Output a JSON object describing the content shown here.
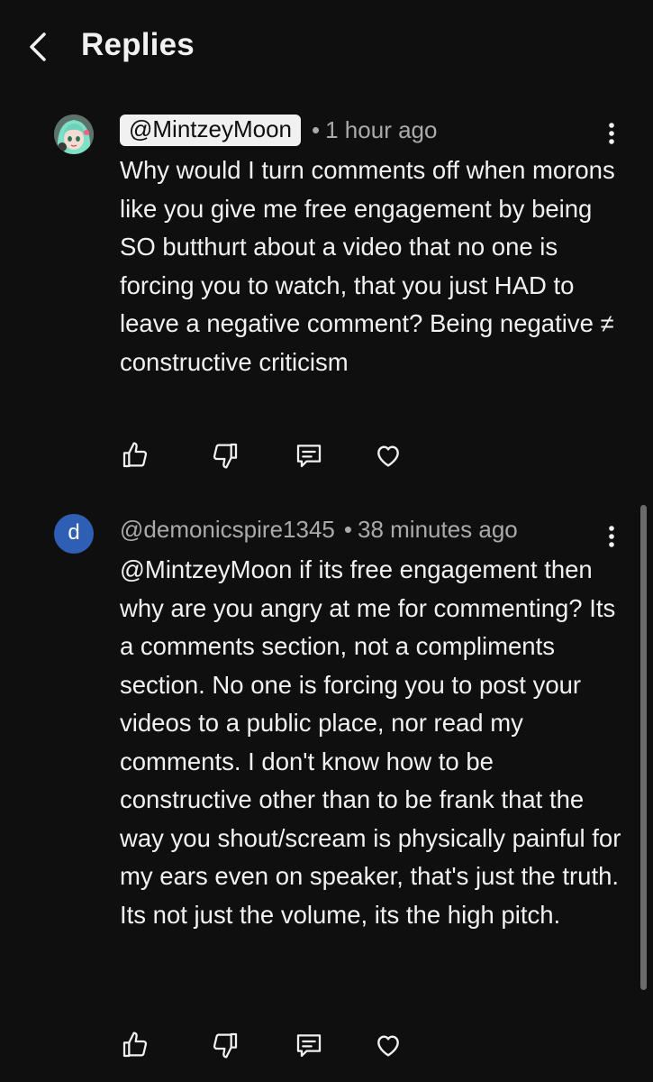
{
  "header": {
    "title": "Replies",
    "back_icon": "chevron-left-icon"
  },
  "comments": [
    {
      "author": "@MintzeyMoon",
      "author_highlight": true,
      "separator": "•",
      "time": "1 hour ago",
      "avatar": {
        "type": "image",
        "description": "anime character avatar",
        "bg": "#6b7d77"
      },
      "text": "Why would I turn comments off when morons like you give me free engagement by being SO butthurt about a video that no one is forcing you to watch, that you just HAD to leave a negative comment? Being negative ≠ constructive criticism",
      "actions": [
        "thumbs-up-icon",
        "thumbs-down-icon",
        "reply-icon",
        "heart-icon"
      ]
    },
    {
      "author": "@demonicspire1345",
      "author_highlight": false,
      "separator": "•",
      "time": "38 minutes ago",
      "avatar": {
        "type": "initial",
        "letter": "d",
        "bg": "#2e5fb4"
      },
      "text": "@MintzeyMoon if its free engagement then why are you angry at me for commenting? Its a comments section, not a compliments section. No one is forcing you to post your videos to a public place, nor read my comments. I don't know how to be constructive other than to be frank that the way you shout/scream is physically painful for my ears even on speaker, that's just the truth. Its not just the volume, its the high pitch.",
      "actions": [
        "thumbs-up-icon",
        "thumbs-down-icon",
        "reply-icon",
        "heart-icon"
      ]
    }
  ],
  "colors": {
    "background": "#0f0f0f",
    "text": "#f1f1f1",
    "secondary_text": "#aaaaaa",
    "chip_bg": "#f1f1f1"
  }
}
